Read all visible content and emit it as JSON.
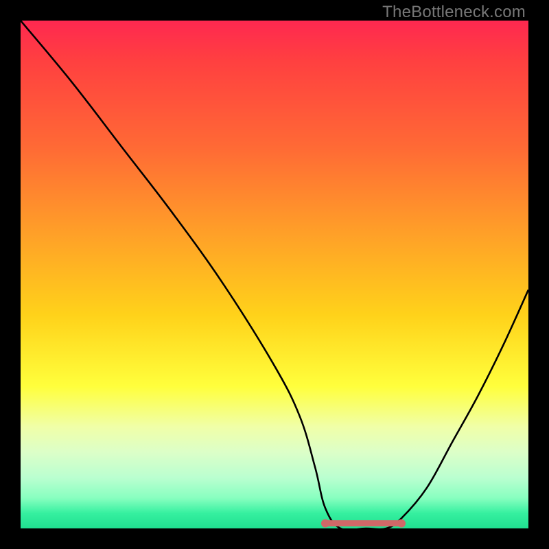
{
  "watermark": "TheBottleneck.com",
  "chart_data": {
    "type": "line",
    "title": "",
    "xlabel": "",
    "ylabel": "",
    "xlim": [
      0,
      100
    ],
    "ylim": [
      0,
      100
    ],
    "series": [
      {
        "name": "bottleneck-curve",
        "x": [
          0,
          10,
          20,
          30,
          40,
          50,
          55,
          58,
          60,
          63,
          68,
          72,
          75,
          80,
          85,
          90,
          95,
          100
        ],
        "values": [
          100,
          88,
          75,
          62,
          48,
          32,
          22,
          12,
          4,
          0,
          0,
          0,
          2,
          8,
          17,
          26,
          36,
          47
        ]
      },
      {
        "name": "optimal-range-marker",
        "x": [
          60,
          63,
          66,
          69,
          72,
          75
        ],
        "values": [
          1,
          1,
          1,
          1,
          1,
          1
        ]
      }
    ],
    "colors": {
      "curve": "#000000",
      "marker": "#d06868"
    }
  }
}
